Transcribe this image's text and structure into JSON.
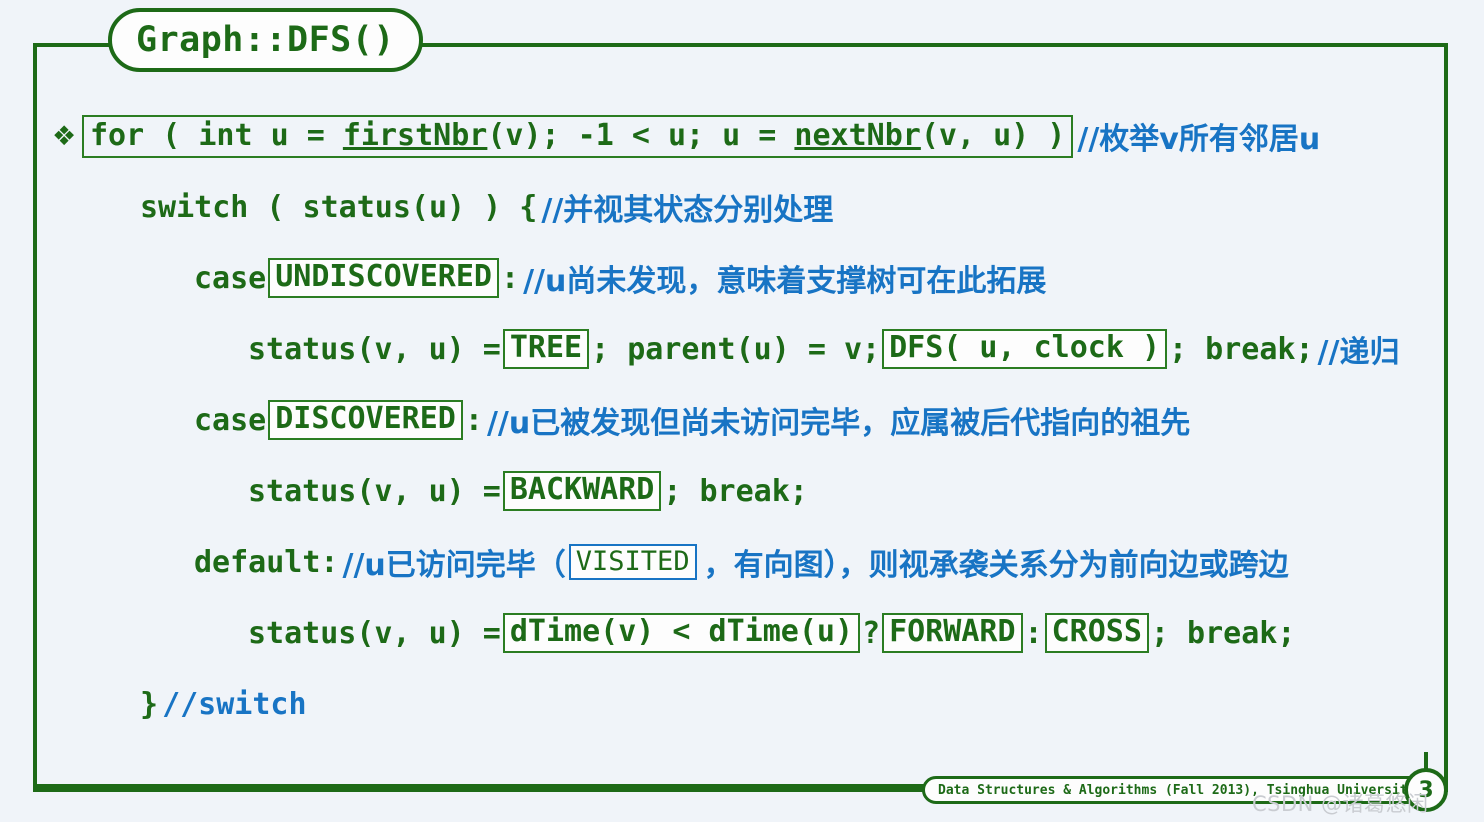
{
  "slide": {
    "title": "Graph::DFS()",
    "bullet_glyph": "❖",
    "accent_green": "#1d6a17",
    "comment_blue": "#1874c4",
    "background": "#f0f4f9"
  },
  "code": {
    "line1": {
      "stmt_a": "for ( int u = ",
      "stmt_fn1": "firstNbr",
      "stmt_b": "(v); -1 < u; u = ",
      "stmt_fn2": "nextNbr",
      "stmt_c": "(v, u) )",
      "comment": "//枚举v所有邻居u"
    },
    "line2": {
      "stmt": "switch ( status(u) ) {",
      "comment": "//并视其状态分别处理"
    },
    "line3": {
      "kw": "case",
      "boxed": "UNDISCOVERED",
      "colon": ":",
      "comment": "//u尚未发现，意味着支撑树可在此拓展"
    },
    "line4": {
      "pre": "status(v, u) = ",
      "boxed1": "TREE",
      "mid": "; parent(u) = v; ",
      "boxed2": "DFS( u, clock )",
      "post": "; break;",
      "comment": "//递归"
    },
    "line5": {
      "kw": "case",
      "boxed": "DISCOVERED",
      "colon": ":",
      "comment": "//u已被发现但尚未访问完毕，应属被后代指向的祖先"
    },
    "line6": {
      "pre": "status(v, u) = ",
      "boxed": "BACKWARD",
      "post": "; break;"
    },
    "line7": {
      "kw": "default:",
      "comment_a": "//u已访问完毕（",
      "boxed": "VISITED",
      "comment_b": "，有向图），则视承袭关系分为前向边或跨边"
    },
    "line8": {
      "pre": "status(v, u) = ",
      "boxed1": "dTime(v) < dTime(u)",
      "mid1": " ? ",
      "boxed2": "FORWARD",
      "mid2": " : ",
      "boxed3": "CROSS",
      "post": "; break;"
    },
    "line9": {
      "stmt": "}",
      "comment": "//switch"
    }
  },
  "footer": {
    "course": "Data Structures & Algorithms (Fall 2013), Tsinghua University",
    "page_number": "3"
  },
  "watermark": {
    "text": "CSDN @诸葛悠闲"
  }
}
